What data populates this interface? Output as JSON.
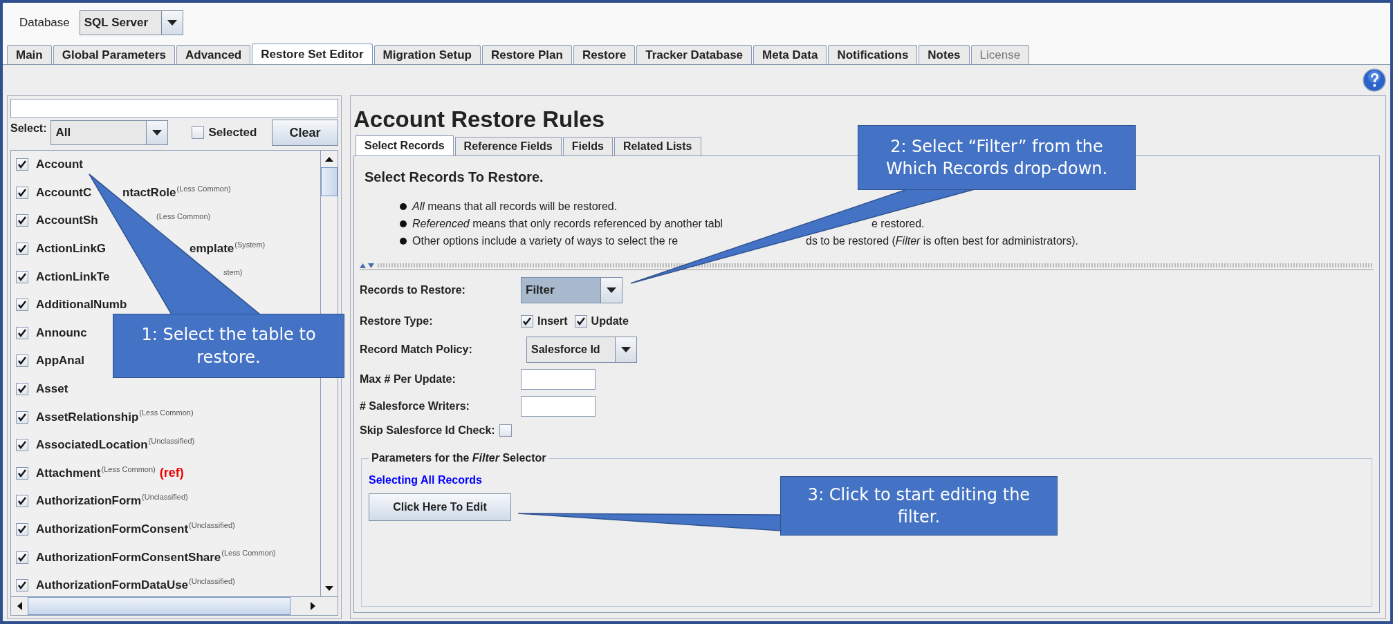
{
  "database": {
    "label": "Database",
    "value": "SQL Server"
  },
  "tabs": [
    {
      "label": "Main",
      "selected": false,
      "disabled": false
    },
    {
      "label": "Global Parameters",
      "selected": false,
      "disabled": false
    },
    {
      "label": "Advanced",
      "selected": false,
      "disabled": false
    },
    {
      "label": "Restore Set Editor",
      "selected": true,
      "disabled": false
    },
    {
      "label": "Migration Setup",
      "selected": false,
      "disabled": false
    },
    {
      "label": "Restore Plan",
      "selected": false,
      "disabled": false
    },
    {
      "label": "Restore",
      "selected": false,
      "disabled": false
    },
    {
      "label": "Tracker Database",
      "selected": false,
      "disabled": false
    },
    {
      "label": "Meta Data",
      "selected": false,
      "disabled": false
    },
    {
      "label": "Notifications",
      "selected": false,
      "disabled": false
    },
    {
      "label": "Notes",
      "selected": false,
      "disabled": false
    },
    {
      "label": "License",
      "selected": false,
      "disabled": true
    }
  ],
  "left_panel": {
    "select_label": "Select:",
    "select_value": "All",
    "selected_checkbox": {
      "label": "Selected",
      "checked": false
    },
    "clear_button": "Clear",
    "tables": [
      {
        "name": "Account",
        "checked": true
      },
      {
        "name": "AccountC",
        "name_tail": "ntactRole",
        "tag": "(Less Common)",
        "checked": true
      },
      {
        "name": "AccountSh",
        "tag": "(Less Common)",
        "checked": true
      },
      {
        "name": "ActionLinkG",
        "name_tail": "emplate",
        "tag": "(System)",
        "checked": true
      },
      {
        "name": "ActionLinkTe",
        "tag": "stem)",
        "checked": true
      },
      {
        "name": "AdditionalNumb",
        "checked": true
      },
      {
        "name": "Announc",
        "checked": true
      },
      {
        "name": "AppAnal",
        "checked": true
      },
      {
        "name": "Asset",
        "checked": true
      },
      {
        "name": "AssetRelationship",
        "tag": "(Less Common)",
        "checked": true
      },
      {
        "name": "AssociatedLocation",
        "tag": "(Unclassified)",
        "checked": true
      },
      {
        "name": "Attachment",
        "tag": "(Less Common)",
        "flag": "(ref)",
        "checked": true
      },
      {
        "name": "AuthorizationForm",
        "tag": "(Unclassified)",
        "checked": true
      },
      {
        "name": "AuthorizationFormConsent",
        "tag": "(Unclassified)",
        "checked": true
      },
      {
        "name": "AuthorizationFormConsentShare",
        "tag": "(Less Common)",
        "checked": true
      },
      {
        "name": "AuthorizationFormDataUse",
        "tag": "(Unclassified)",
        "checked": true
      }
    ]
  },
  "right_panel": {
    "title": "Account Restore Rules",
    "subtabs": [
      {
        "label": "Select Records",
        "selected": true
      },
      {
        "label": "Reference Fields",
        "selected": false
      },
      {
        "label": "Fields",
        "selected": false
      },
      {
        "label": "Related Lists",
        "selected": false
      }
    ],
    "heading": "Select Records To Restore.",
    "bullets": [
      {
        "text": "*All* means that all records will be restored."
      },
      {
        "text": "*Referenced* means that only records referenced by another tabl",
        "tail": "e restored."
      },
      {
        "text": "Other options include a variety of ways to select the re",
        "tail": "ds to be restored (*Filter* is often best for administrators)."
      }
    ],
    "records_to_restore": {
      "label": "Records to Restore:",
      "value": "Filter"
    },
    "restore_type": {
      "label": "Restore Type:",
      "options": [
        {
          "label": "Insert",
          "checked": true
        },
        {
          "label": "Update",
          "checked": true
        }
      ]
    },
    "record_match_policy": {
      "label": "Record Match Policy:",
      "value": "Salesforce Id"
    },
    "max_per_update": {
      "label": "Max # Per Update:"
    },
    "salesforce_writers": {
      "label": "# Salesforce Writers:"
    },
    "skip_id_check": {
      "label": "Skip Salesforce Id Check:",
      "checked": false
    },
    "parameters": {
      "legend": "Parameters for the *Filter* Selector",
      "status": "Selecting All Records",
      "edit_button": "Click Here To Edit"
    }
  },
  "callouts": [
    "1: Select the table to restore.",
    "2: Select “Filter” from the Which Records drop-down.",
    "3: Click to start editing the filter."
  ]
}
